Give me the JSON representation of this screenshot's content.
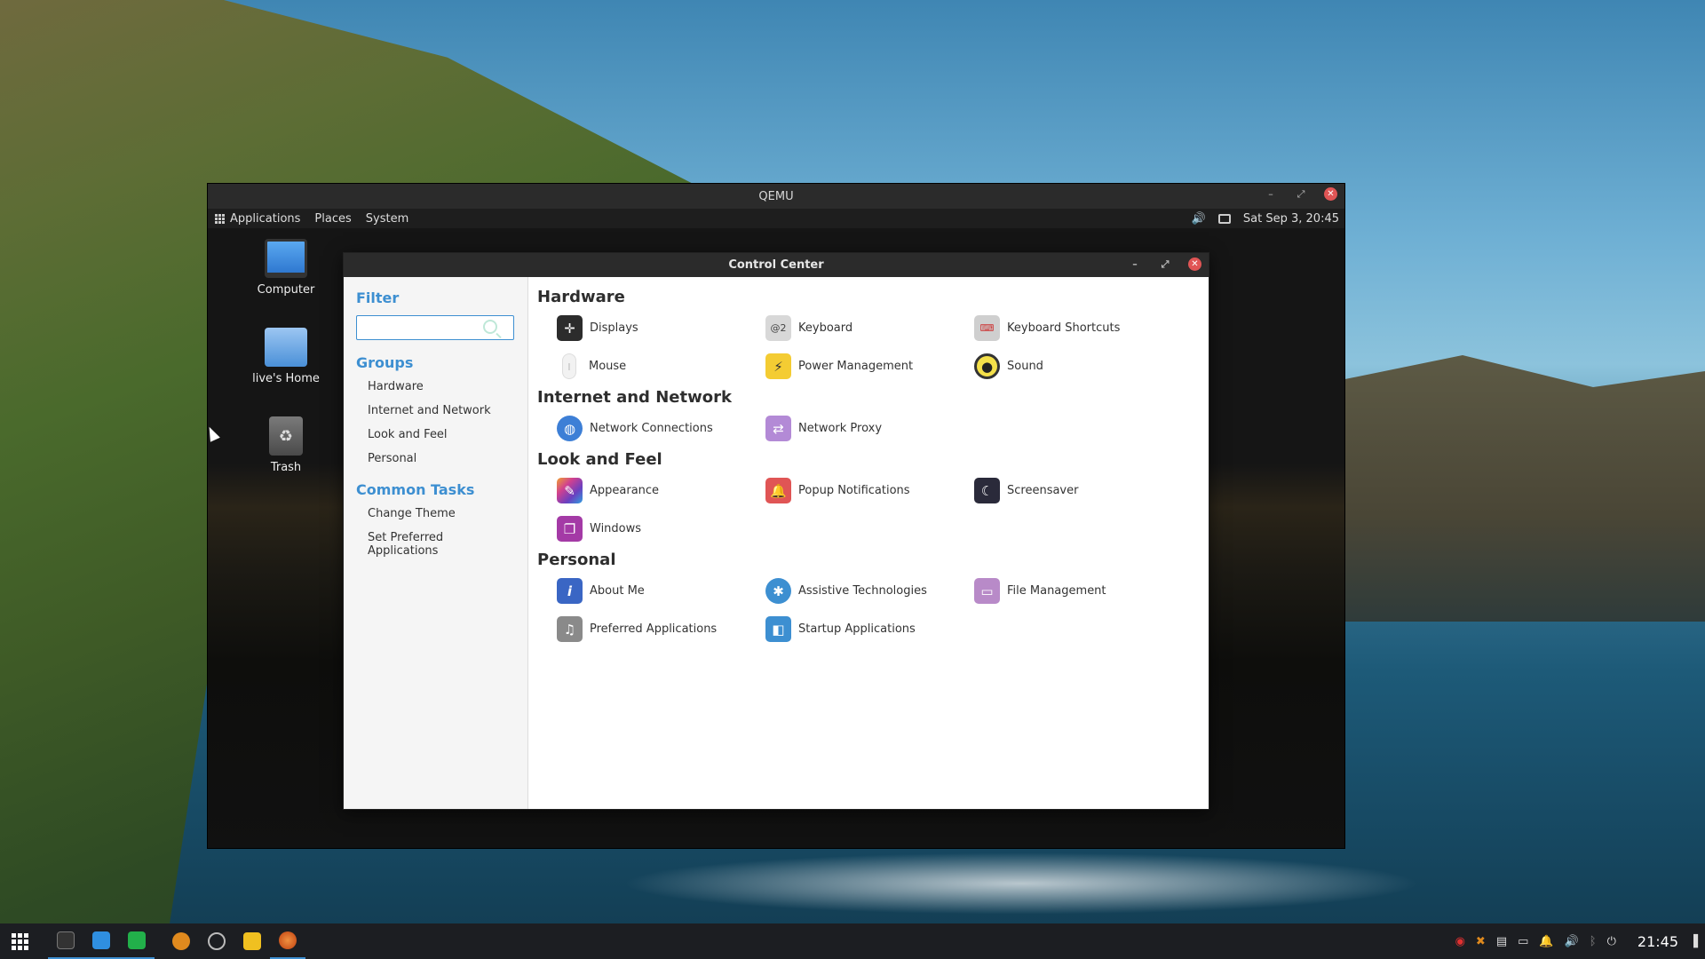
{
  "qemu": {
    "title": "QEMU"
  },
  "guest_panel": {
    "menus": [
      "Applications",
      "Places",
      "System"
    ],
    "datetime": "Sat Sep  3, 20:45"
  },
  "desktop_icons": [
    {
      "label": "Computer",
      "icon": "computer-icon"
    },
    {
      "label": "live's Home",
      "icon": "home-folder-icon"
    },
    {
      "label": "Trash",
      "icon": "trash-icon"
    }
  ],
  "control_center": {
    "title": "Control Center",
    "filter_heading": "Filter",
    "filter_value": "",
    "groups_heading": "Groups",
    "groups": [
      "Hardware",
      "Internet and Network",
      "Look and Feel",
      "Personal"
    ],
    "common_tasks_heading": "Common Tasks",
    "common_tasks": [
      "Change Theme",
      "Set Preferred Applications"
    ],
    "sections": [
      {
        "title": "Hardware",
        "items": [
          {
            "label": "Displays",
            "icon": "displays-icon",
            "color": "#2c2c2c"
          },
          {
            "label": "Keyboard",
            "icon": "keyboard-icon",
            "color": "#d8d8d8"
          },
          {
            "label": "Keyboard Shortcuts",
            "icon": "keyboard-shortcuts-icon",
            "color": "#cfcfcf"
          },
          {
            "label": "Mouse",
            "icon": "mouse-icon",
            "color": "#f2f2f2"
          },
          {
            "label": "Power Management",
            "icon": "power-icon",
            "color": "#f4cc33"
          },
          {
            "label": "Sound",
            "icon": "sound-icon",
            "color": "#f4e04a"
          }
        ]
      },
      {
        "title": "Internet and Network",
        "items": [
          {
            "label": "Network Connections",
            "icon": "network-icon",
            "color": "#3d7fd6"
          },
          {
            "label": "Network Proxy",
            "icon": "proxy-icon",
            "color": "#b38ad6"
          }
        ]
      },
      {
        "title": "Look and Feel",
        "items": [
          {
            "label": "Appearance",
            "icon": "appearance-icon",
            "color": "#c24aa8"
          },
          {
            "label": "Popup Notifications",
            "icon": "bell-icon",
            "color": "#e05555"
          },
          {
            "label": "Screensaver",
            "icon": "moon-icon",
            "color": "#2a2a3a"
          },
          {
            "label": "Windows",
            "icon": "windows-icon",
            "color": "#a43aa6"
          }
        ]
      },
      {
        "title": "Personal",
        "items": [
          {
            "label": "About Me",
            "icon": "info-icon",
            "color": "#3a66c4"
          },
          {
            "label": "Assistive Technologies",
            "icon": "accessibility-icon",
            "color": "#3d8fd1"
          },
          {
            "label": "File Management",
            "icon": "folder-icon",
            "color": "#b88ac8"
          },
          {
            "label": "Preferred Applications",
            "icon": "preferred-apps-icon",
            "color": "#8a8a8a"
          },
          {
            "label": "Startup Applications",
            "icon": "startup-icon",
            "color": "#3d8fd1"
          }
        ]
      }
    ]
  },
  "taskbar": {
    "apps": [
      {
        "icon": "app-grid-icon",
        "color": "#ffffff"
      },
      {
        "icon": "terminal-icon",
        "color": "#333333"
      },
      {
        "icon": "download-icon",
        "color": "#2f8fe0"
      },
      {
        "icon": "green-app-icon",
        "color": "#22b04a"
      },
      {
        "icon": "x-app-icon",
        "color": "#e08a1e"
      },
      {
        "icon": "browser-icon",
        "color": "#888888"
      },
      {
        "icon": "yellow-app-icon",
        "color": "#f0c020"
      },
      {
        "icon": "qemu-icon",
        "color": "#e06020"
      }
    ],
    "clock": "21:45"
  }
}
